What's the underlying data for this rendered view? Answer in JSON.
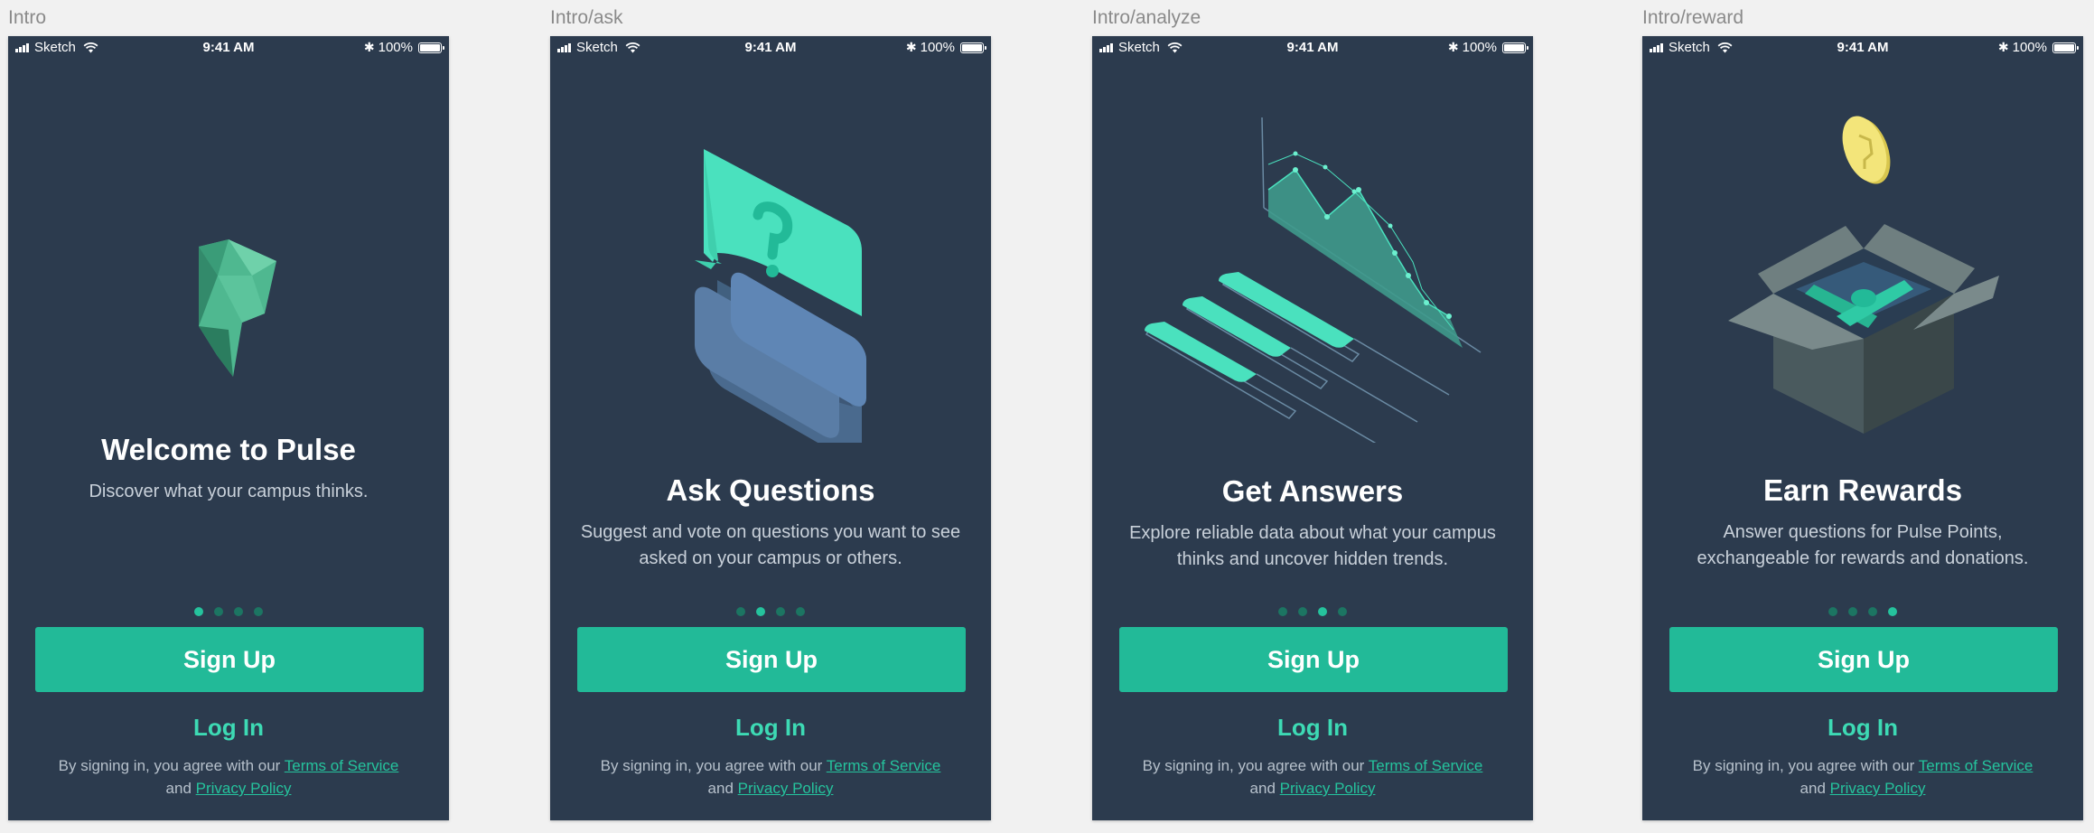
{
  "status_bar": {
    "carrier": "Sketch",
    "time": "9:41 AM",
    "battery": "100%"
  },
  "common": {
    "signup_label": "Sign Up",
    "login_label": "Log In",
    "terms_prefix": "By signing in, you agree with our",
    "terms_link": "Terms of Service",
    "terms_and": "and",
    "privacy_link": "Privacy Policy"
  },
  "screens": [
    {
      "label": "Intro",
      "title": "Welcome to Pulse",
      "subtitle": "Discover what your campus thinks.",
      "illustration": "pulse-logo-icon",
      "active_dot": 0
    },
    {
      "label": "Intro/ask",
      "title": "Ask Questions",
      "subtitle": "Suggest and vote on questions you want to see asked on your campus or others.",
      "illustration": "question-bubbles-icon",
      "active_dot": 1
    },
    {
      "label": "Intro/analyze",
      "title": "Get Answers",
      "subtitle": "Explore reliable data about what your campus thinks and uncover hidden trends.",
      "illustration": "data-chart-icon",
      "active_dot": 2
    },
    {
      "label": "Intro/reward",
      "title": "Earn Rewards",
      "subtitle": "Answer questions for Pulse Points, exchangeable for rewards and donations.",
      "illustration": "reward-box-icon",
      "active_dot": 3
    }
  ],
  "colors": {
    "phone_bg": "#2c3b4e",
    "accent": "#22ba98",
    "login": "#3ddab4",
    "dot_inactive": "#1c7562",
    "dot_active": "#25c39d"
  }
}
